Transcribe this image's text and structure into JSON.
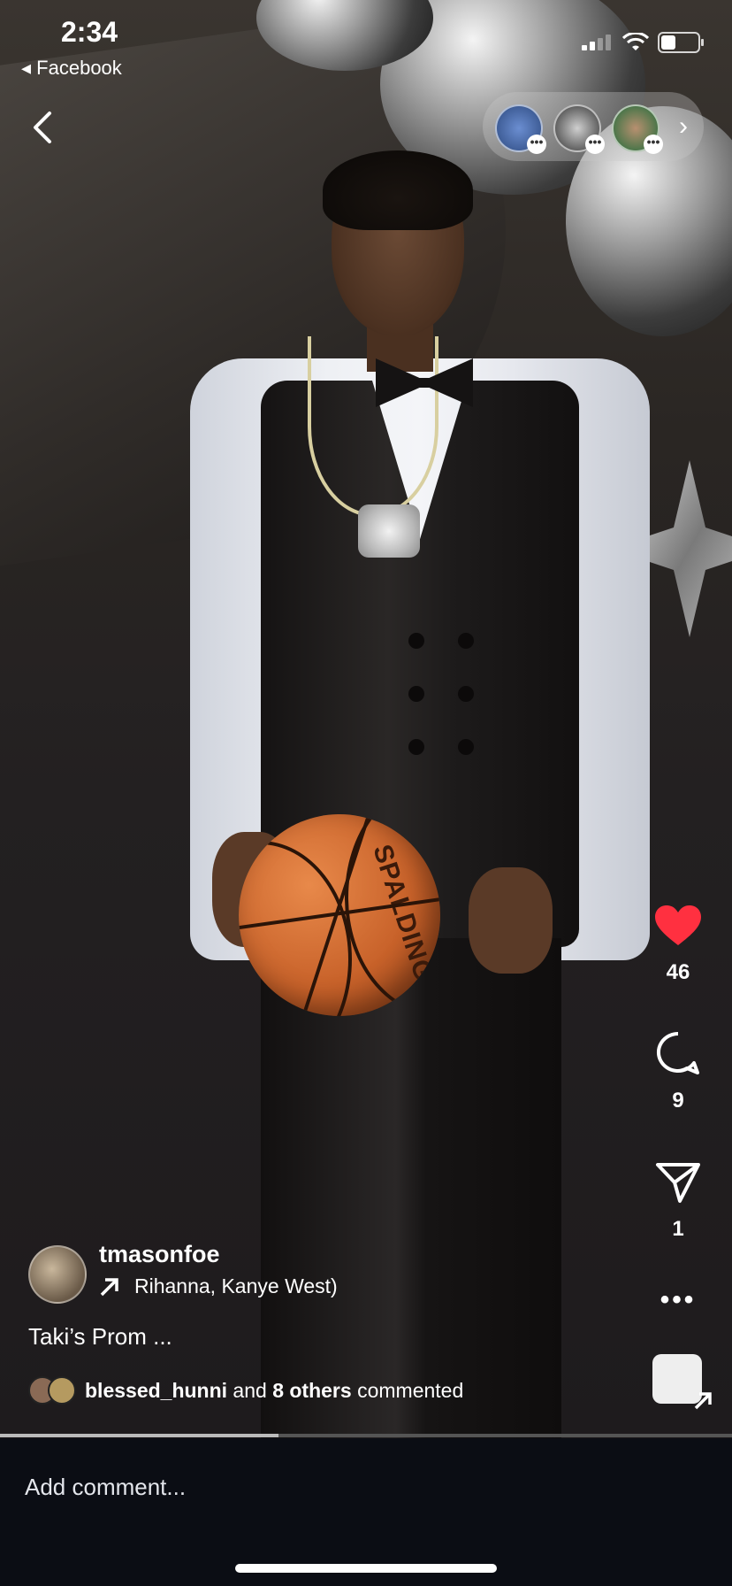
{
  "status_bar": {
    "time": "2:34",
    "back_app": "Facebook"
  },
  "reel": {
    "username": "tmasonfoe",
    "audio": "Rihanna, Kanye West)",
    "caption": "Taki’s Prom ...",
    "commented": {
      "user": "blessed_hunni",
      "middle": " and ",
      "others": "8 others",
      "suffix": " commented"
    },
    "likes": "46",
    "comments": "9",
    "shares": "1",
    "ball_brand": "SPALDING"
  },
  "comment_bar": {
    "placeholder": "Add comment..."
  },
  "colors": {
    "like": "#ff3040",
    "comment_bar_bg": "#0b0d14"
  },
  "icons": {
    "back": "chevron-left-icon",
    "like": "heart-filled-icon",
    "comment": "comment-bubble-icon",
    "share": "paper-plane-icon",
    "more": "more-dots-icon"
  }
}
